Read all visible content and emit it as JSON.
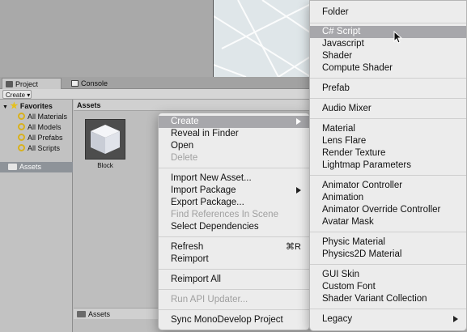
{
  "tabs": {
    "project": "Project",
    "console": "Console"
  },
  "toolbar": {
    "create": "Create ▾"
  },
  "tree": {
    "favorites": "Favorites",
    "items": [
      "All Materials",
      "All Models",
      "All Prefabs",
      "All Scripts"
    ],
    "assets": "Assets"
  },
  "assets_pane": {
    "header": "Assets",
    "tile_label": "Block",
    "footer": "Assets"
  },
  "context_menu": {
    "create": "Create",
    "reveal": "Reveal in Finder",
    "open": "Open",
    "delete": "Delete",
    "import_new": "Import New Asset...",
    "import_package": "Import Package",
    "export_package": "Export Package...",
    "find_refs": "Find References In Scene",
    "select_deps": "Select Dependencies",
    "refresh": "Refresh",
    "refresh_shortcut": "⌘R",
    "reimport": "Reimport",
    "reimport_all": "Reimport All",
    "run_api": "Run API Updater...",
    "sync": "Sync MonoDevelop Project"
  },
  "create_submenu": {
    "folder": "Folder",
    "csharp": "C# Script",
    "javascript": "Javascript",
    "shader": "Shader",
    "compute_shader": "Compute Shader",
    "prefab": "Prefab",
    "audio_mixer": "Audio Mixer",
    "material": "Material",
    "lens_flare": "Lens Flare",
    "render_texture": "Render Texture",
    "lightmap_params": "Lightmap Parameters",
    "animator_controller": "Animator Controller",
    "animation": "Animation",
    "animator_override": "Animator Override Controller",
    "avatar_mask": "Avatar Mask",
    "physic_material": "Physic Material",
    "physics2d_material": "Physics2D Material",
    "gui_skin": "GUI Skin",
    "custom_font": "Custom Font",
    "shader_variant": "Shader Variant Collection",
    "legacy": "Legacy"
  },
  "colors": {
    "highlight": "#a7a7ab",
    "menu_bg": "#ececec",
    "tree_selected": "#8e9399",
    "favorite_icon": "#d8b11d"
  }
}
